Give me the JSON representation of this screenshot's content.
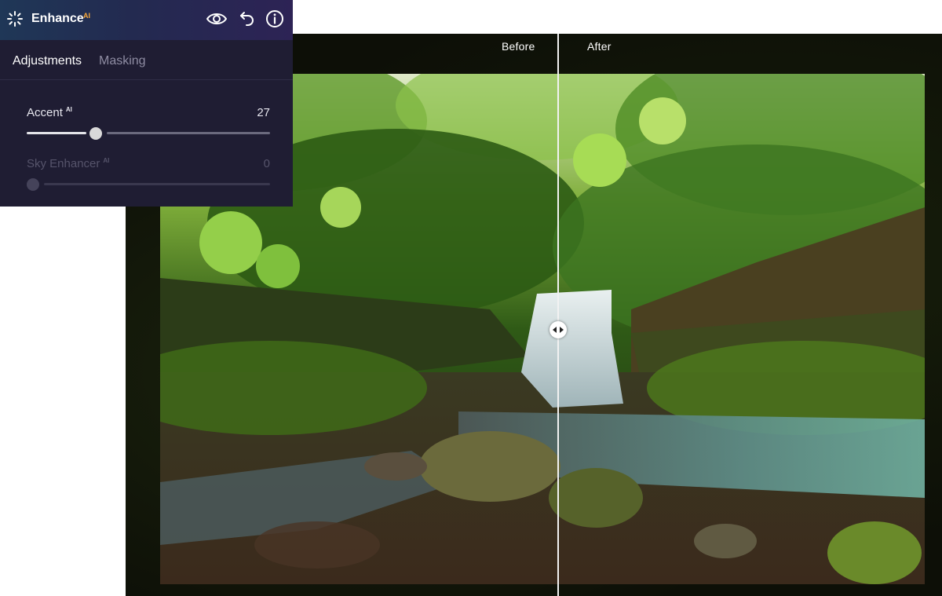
{
  "panel": {
    "title": "Enhance",
    "title_badge": "AI",
    "header_icons": [
      "sparkle-icon",
      "eye-icon",
      "undo-icon",
      "info-icon"
    ],
    "tabs": [
      {
        "label": "Adjustments",
        "active": true
      },
      {
        "label": "Masking",
        "active": false
      }
    ],
    "sliders": [
      {
        "label": "Accent",
        "badge": "AI",
        "value": "27",
        "fraction": 0.27,
        "enabled": true
      },
      {
        "label": "Sky Enhancer",
        "badge": "AI",
        "value": "0",
        "fraction": 0.0,
        "enabled": false
      }
    ]
  },
  "viewer": {
    "before_label": "Before",
    "after_label": "After",
    "split_fraction": 0.52
  },
  "colors": {
    "accent_badge": "#f7a83b",
    "panel_bg": "#1f1d33",
    "slider_thumb": "#d9d9d9"
  }
}
